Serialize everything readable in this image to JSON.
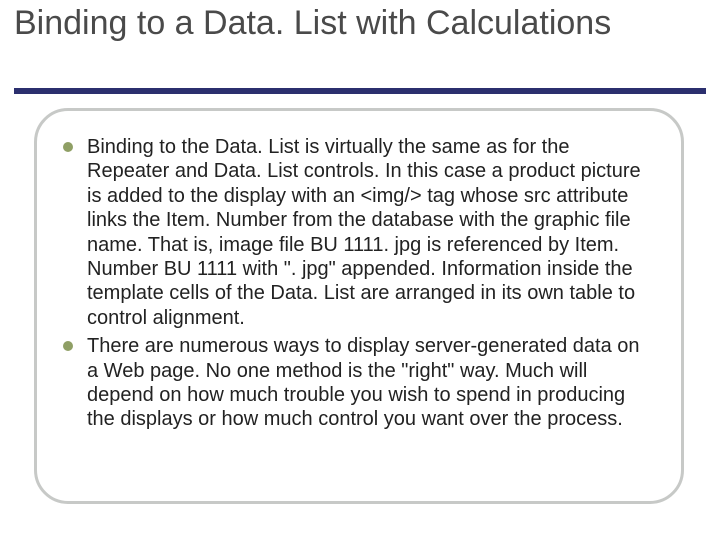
{
  "title": "Binding to a Data. List with Calculations",
  "bullets": [
    "Binding to the Data. List is virtually the same as for the Repeater and Data. List controls. In this case a product picture is added to the display with an <img/> tag whose src attribute links the Item. Number from the database with the graphic file name. That is, image file BU 1111. jpg is referenced by Item. Number BU 1111 with \". jpg\" appended. Information inside the template cells of the Data. List are arranged in its own table to control alignment.",
    "There are numerous ways to display server-generated data on a Web page. No one method is the \"right\" way. Much will depend on how much trouble you wish to spend in producing the displays or how much control you want over the process."
  ]
}
